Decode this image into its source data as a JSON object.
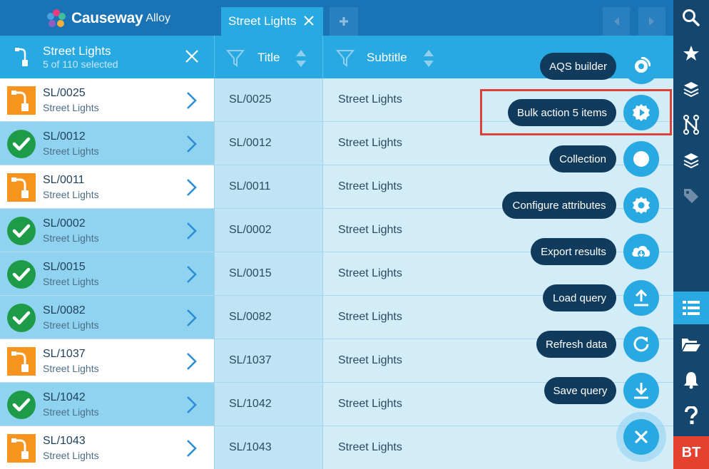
{
  "app": {
    "brand": "Causeway",
    "sub": "Alloy"
  },
  "tabs": {
    "active_label": "Street Lights"
  },
  "list_header": {
    "title": "Street Lights",
    "subtitle": "5 of 110 selected"
  },
  "columns": {
    "title": "Title",
    "subtitle": "Subtitle"
  },
  "rows": [
    {
      "code": "SL/0025",
      "type": "Street Lights",
      "selected": false
    },
    {
      "code": "SL/0012",
      "type": "Street Lights",
      "selected": true
    },
    {
      "code": "SL/0011",
      "type": "Street Lights",
      "selected": false
    },
    {
      "code": "SL/0002",
      "type": "Street Lights",
      "selected": true
    },
    {
      "code": "SL/0015",
      "type": "Street Lights",
      "selected": true
    },
    {
      "code": "SL/0082",
      "type": "Street Lights",
      "selected": true
    },
    {
      "code": "SL/1037",
      "type": "Street Lights",
      "selected": false
    },
    {
      "code": "SL/1042",
      "type": "Street Lights",
      "selected": true
    },
    {
      "code": "SL/1043",
      "type": "Street Lights",
      "selected": false
    }
  ],
  "fab_menu": [
    {
      "label": "AQS builder",
      "icon": "aqs-icon"
    },
    {
      "label": "Bulk action 5 items",
      "icon": "bulk-action-icon"
    },
    {
      "label": "Collection",
      "icon": "collection-icon"
    },
    {
      "label": "Configure attributes",
      "icon": "gear-icon"
    },
    {
      "label": "Export results",
      "icon": "cloud-download-icon"
    },
    {
      "label": "Load query",
      "icon": "upload-icon"
    },
    {
      "label": "Refresh data",
      "icon": "refresh-icon"
    },
    {
      "label": "Save query",
      "icon": "download-icon"
    }
  ],
  "sidebar": {
    "user_initials": "BT"
  },
  "colors": {
    "primary": "#29a9e1",
    "dark": "#15466e",
    "topbar": "#1a73b4",
    "selected_row": "#8fd3f0",
    "highlight": "#e0403a",
    "lamp": "#f7941d",
    "check": "#1e9b48"
  }
}
